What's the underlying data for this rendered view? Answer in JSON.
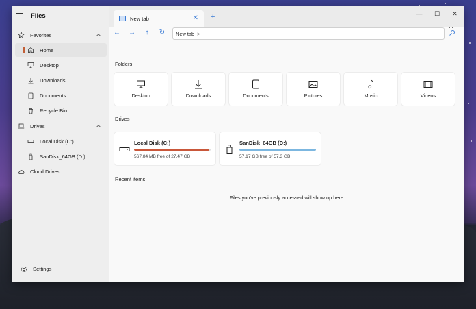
{
  "app": {
    "title": "Files"
  },
  "sidebar": {
    "items": [
      {
        "label": "Favorites",
        "icon": "star-icon",
        "level": 0,
        "expandable": true
      },
      {
        "label": "Home",
        "icon": "home-icon",
        "level": 1,
        "active": true
      },
      {
        "label": "Desktop",
        "icon": "desktop-icon",
        "level": 1
      },
      {
        "label": "Downloads",
        "icon": "download-icon",
        "level": 1
      },
      {
        "label": "Documents",
        "icon": "document-icon",
        "level": 1
      },
      {
        "label": "Recycle Bin",
        "icon": "recycle-bin-icon",
        "level": 1
      },
      {
        "label": "Drives",
        "icon": "laptop-icon",
        "level": 0,
        "expandable": true
      },
      {
        "label": "Local Disk (C:)",
        "icon": "hard-drive-icon",
        "level": 1
      },
      {
        "label": "SanDisk_64GB (D:)",
        "icon": "usb-drive-icon",
        "level": 1
      },
      {
        "label": "Cloud Drives",
        "icon": "cloud-icon",
        "level": 0
      }
    ],
    "settings_label": "Settings"
  },
  "tabs": [
    {
      "label": "New tab"
    }
  ],
  "address": {
    "path": "New tab",
    "separator": ">"
  },
  "sections": {
    "folders": "Folders",
    "drives": "Drives",
    "recent": "Recent items"
  },
  "folders": [
    {
      "label": "Desktop",
      "icon": "desktop-icon"
    },
    {
      "label": "Downloads",
      "icon": "download-icon"
    },
    {
      "label": "Documents",
      "icon": "document-icon"
    },
    {
      "label": "Pictures",
      "icon": "picture-icon"
    },
    {
      "label": "Music",
      "icon": "music-note-icon"
    },
    {
      "label": "Videos",
      "icon": "video-icon"
    }
  ],
  "drives": [
    {
      "name": "Local Disk (C:)",
      "free_text": "567.84 MB free of 27.47 GB",
      "used_fraction": 0.98,
      "bar_color": "#c9573a",
      "icon": "hard-drive-icon"
    },
    {
      "name": "SanDisk_64GB (D:)",
      "free_text": "57.17 GB free of 57.3 GB",
      "used_fraction": 1.0,
      "bar_color": "#7cb7e0",
      "icon": "usb-drive-icon"
    }
  ],
  "recent_empty_message": "Files you've previously accessed will show up here",
  "colors": {
    "accent": "#3a7bd5",
    "sidebar_active_marker": "#c25f36"
  }
}
